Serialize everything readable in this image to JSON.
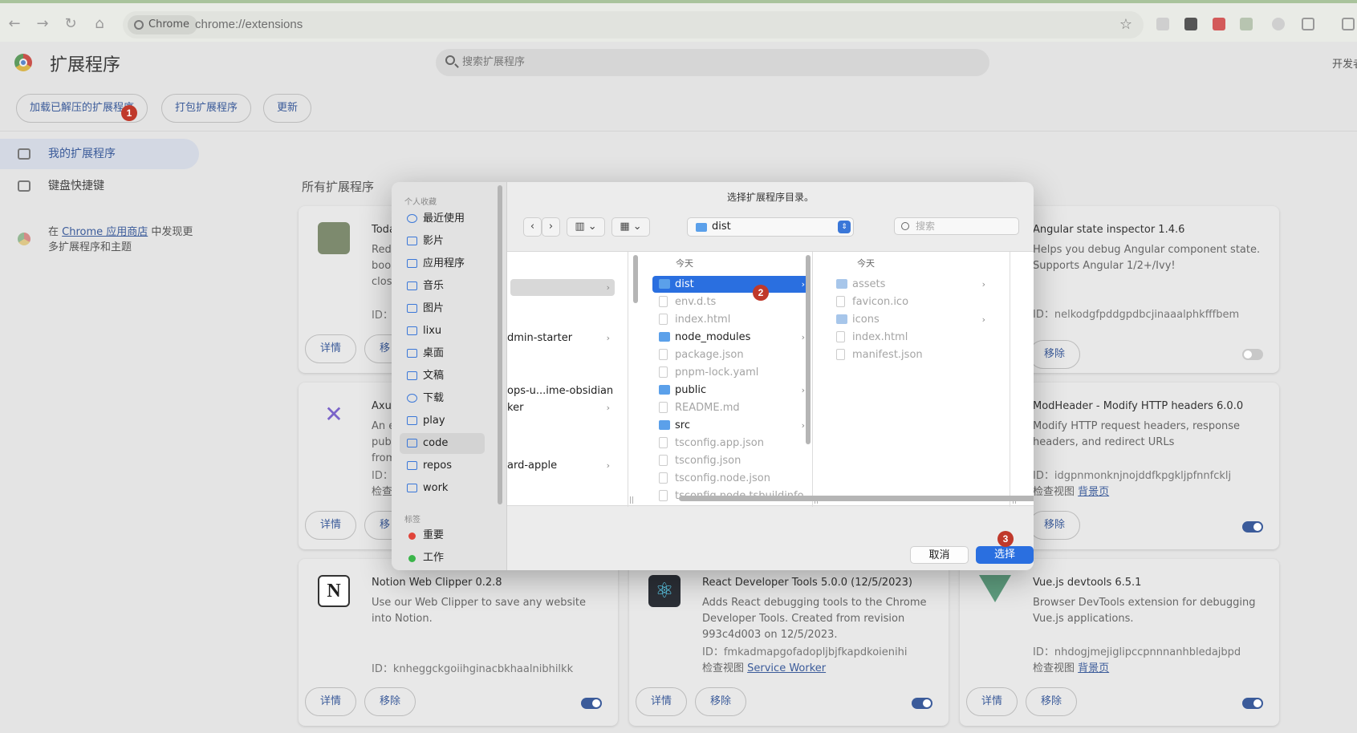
{
  "browser": {
    "chip_label": "Chrome",
    "url": "chrome://extensions"
  },
  "page": {
    "title": "扩展程序",
    "search_placeholder": "搜索扩展程序",
    "dev_mode_label": "开发者模式",
    "buttons": {
      "load_unpacked": "加载已解压的扩展程序",
      "pack": "打包扩展程序",
      "update": "更新"
    }
  },
  "sidebar": {
    "items": [
      {
        "label": "我的扩展程序"
      },
      {
        "label": "键盘快捷键"
      }
    ],
    "note_prefix": "在 ",
    "note_link": "Chrome 应用商店",
    "note_suffix": " 中发现更多扩展程序和主题"
  },
  "section_title": "所有扩展程序",
  "cards": [
    {
      "name": "Toda",
      "desc": "Red\nboo\nclos",
      "id": "ID：",
      "details": "详情",
      "remove": "移"
    },
    {
      "name": "Angular state inspector  1.4.6",
      "desc": "Helps you debug Angular component state. Supports Angular 1/2+/Ivy!",
      "id": "ID：nelkodgfpddgpdbcjinaaalphkfffbem",
      "details": "详情",
      "remove": "移除",
      "enabled": false
    },
    {
      "name": "Axu",
      "desc": "An e\npub\nfrom",
      "id": "ID：",
      "inspect": "检查",
      "details": "详情",
      "remove": "移"
    },
    {
      "name": "ModHeader - Modify HTTP headers  6.0.0",
      "desc": "Modify HTTP request headers, response headers, and redirect URLs",
      "id": "ID：idgpnmonknjnojddfkpgkljpfnnfcklj",
      "inspect_prefix": "检查视图 ",
      "inspect_link": "背景页",
      "details": "详情",
      "remove": "移除",
      "enabled": true
    },
    {
      "name": "Notion Web Clipper  0.2.8",
      "desc": "Use our Web Clipper to save any website into Notion.",
      "id": "ID：knheggckgoiihginacbkhaalnibhilkk",
      "details": "详情",
      "remove": "移除",
      "enabled": true
    },
    {
      "name": "React Developer Tools  5.0.0 (12/5/2023)",
      "desc": "Adds React debugging tools to the Chrome Developer Tools. Created from revision 993c4d003 on 12/5/2023.",
      "id": "ID：fmkadmapgofadopljbjfkapdkoienihi",
      "inspect_prefix": "检查视图 ",
      "inspect_link": "Service Worker",
      "details": "详情",
      "remove": "移除",
      "enabled": true
    },
    {
      "name": "Vue.js devtools  6.5.1",
      "desc": "Browser DevTools extension for debugging Vue.js applications.",
      "id": "ID：nhdogjmejiglipccpnnnanhbledajbpd",
      "inspect_prefix": "检查视图 ",
      "inspect_link": "背景页",
      "details": "详情",
      "remove": "移除",
      "enabled": true
    }
  ],
  "dialog": {
    "title": "选择扩展程序目录。",
    "favorites_header": "个人收藏",
    "favorites": [
      "最近使用",
      "影片",
      "应用程序",
      "音乐",
      "图片",
      "lixu",
      "桌面",
      "文稿",
      "下载",
      "play",
      "code",
      "repos",
      "work"
    ],
    "tags_header": "标签",
    "tags": [
      {
        "label": "重要",
        "color": "#e0443a"
      },
      {
        "label": "工作",
        "color": "#3bb54a"
      }
    ],
    "path": "dist",
    "search_placeholder": "搜索",
    "col1_rows": [
      "",
      "dmin-starter",
      "ops-u...ime-obsidian",
      "ker",
      "ard-apple"
    ],
    "col2_header": "今天",
    "col2_rows": [
      {
        "name": "dist",
        "type": "folder",
        "chevron": true,
        "selected": true
      },
      {
        "name": "env.d.ts",
        "type": "file"
      },
      {
        "name": "index.html",
        "type": "file"
      },
      {
        "name": "node_modules",
        "type": "folder",
        "chevron": true
      },
      {
        "name": "package.json",
        "type": "file"
      },
      {
        "name": "pnpm-lock.yaml",
        "type": "file"
      },
      {
        "name": "public",
        "type": "folder",
        "chevron": true
      },
      {
        "name": "README.md",
        "type": "file"
      },
      {
        "name": "src",
        "type": "folder",
        "chevron": true
      },
      {
        "name": "tsconfig.app.json",
        "type": "file"
      },
      {
        "name": "tsconfig.json",
        "type": "file"
      },
      {
        "name": "tsconfig.node.json",
        "type": "file"
      },
      {
        "name": "tsconfig.node.tsbuildinfo",
        "type": "file"
      }
    ],
    "col3_header": "今天",
    "col3_rows": [
      {
        "name": "assets",
        "type": "folder",
        "chevron": true
      },
      {
        "name": "favicon.ico",
        "type": "file"
      },
      {
        "name": "icons",
        "type": "folder",
        "chevron": true
      },
      {
        "name": "index.html",
        "type": "file"
      },
      {
        "name": "manifest.json",
        "type": "file"
      }
    ],
    "cancel_label": "取消",
    "ok_label": "选择"
  },
  "badges": [
    "1",
    "2",
    "3"
  ],
  "colors": {
    "accent": "#2a6fe0",
    "link": "#3b5b9a",
    "badge": "#c0392b"
  }
}
